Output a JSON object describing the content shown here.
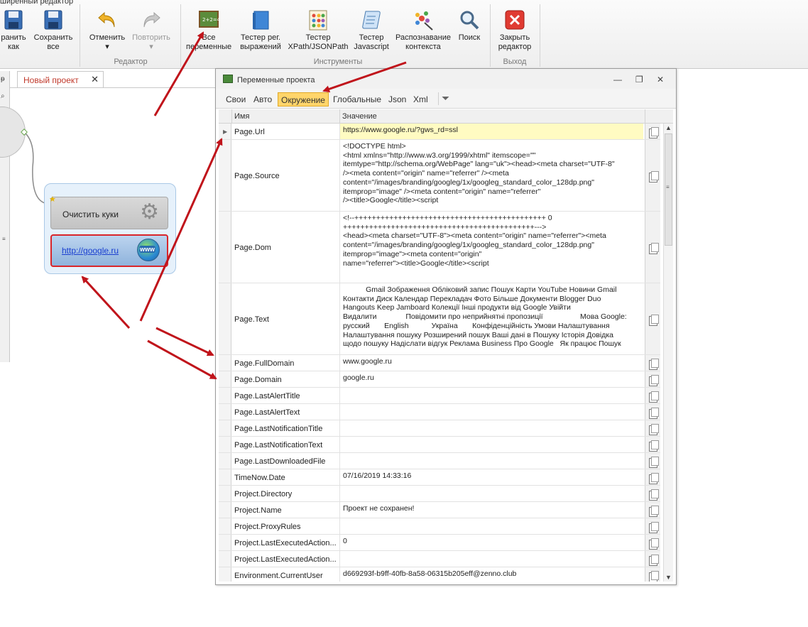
{
  "window_title": "ширенный редактор",
  "ribbon": {
    "buttons": [
      {
        "label": "ранить\nкак"
      },
      {
        "label": "Сохранить\nвсе"
      },
      {
        "label": "Отменить\n▾"
      },
      {
        "label": "Повторить\n▾"
      },
      {
        "label": "Все\nпеременные"
      },
      {
        "label": "Тестер рег.\nвыражений"
      },
      {
        "label": "Тестер\nXPath/JSONPath"
      },
      {
        "label": "Тестер\nJavascript"
      },
      {
        "label": "Распознавание\nконтекста"
      },
      {
        "label": "Поиск"
      },
      {
        "label": "Закрыть\nредактор"
      }
    ],
    "groups": {
      "editor": "Редактор",
      "tools": "Инструменты",
      "exit": "Выход"
    }
  },
  "document_tab": {
    "title": "Новый проект",
    "close": "✕"
  },
  "canvas": {
    "node_clear_label": "Очистить куки",
    "node_url_label": "http://google.ru",
    "globe_text": "www"
  },
  "variables_window": {
    "title": "Переменные проекта",
    "tabs": [
      "Свои",
      "Авто",
      "Окружение",
      "Глобальные",
      "Json",
      "Xml"
    ],
    "active_tab": "Окружение",
    "columns": {
      "name": "Имя",
      "value": "Значение"
    },
    "rows": [
      {
        "name": "Page.Url",
        "value": "https://www.google.ru/?gws_rd=ssl"
      },
      {
        "name": "Page.Source",
        "value": "<!DOCTYPE html>\n<html xmlns=\"http://www.w3.org/1999/xhtml\" itemscope=\"\"\nitemtype=\"http://schema.org/WebPage\" lang=\"uk\"><head><meta charset=\"UTF-8\"\n/><meta content=\"origin\" name=\"referrer\" /><meta\ncontent=\"/images/branding/googleg/1x/googleg_standard_color_128dp.png\"\nitemprop=\"image\" /><meta content=\"origin\" name=\"referrer\"\n/><title>Google</title><script"
      },
      {
        "name": "Page.Dom",
        "value": "<!--++++++++++++++++++++++++++++++++++++++++++++ 0\n++++++++++++++++++++++++++++++++++++++++++++--->\n<head><meta charset=\"UTF-8\"><meta content=\"origin\" name=\"referrer\"><meta\ncontent=\"/images/branding/googleg/1x/googleg_standard_color_128dp.png\"\nitemprop=\"image\"><meta content=\"origin\"\nname=\"referrer\"><title>Google</title><script"
      },
      {
        "name": "Page.Text",
        "value": "           Gmail Зображення Обліковий запис Пошук Карти YouTube Новини Gmail\nКонтакти Диск Календар Перекладач Фото Більше Документи Blogger Duo\nHangouts Keep Jamboard Колекції Інші продукти від Google Увійти\nВидалити              Повідомити про неприйнятні пропозиції                  Мова Google:\nрусский       English           Україна       Конфіденційність Умови Налаштування\nНалаштування пошуку Розширений пошук Ваші дані в Пошуку Історія Довідка\nщодо пошуку Надіслати відгук Реклама Business Про Google   Як працює Пошук"
      },
      {
        "name": "Page.FullDomain",
        "value": "www.google.ru"
      },
      {
        "name": "Page.Domain",
        "value": "google.ru"
      },
      {
        "name": "Page.LastAlertTitle",
        "value": ""
      },
      {
        "name": "Page.LastAlertText",
        "value": ""
      },
      {
        "name": "Page.LastNotificationTitle",
        "value": ""
      },
      {
        "name": "Page.LastNotificationText",
        "value": ""
      },
      {
        "name": "Page.LastDownloadedFile",
        "value": ""
      },
      {
        "name": "TimeNow.Date",
        "value": "07/16/2019 14:33:16"
      },
      {
        "name": "Project.Directory",
        "value": ""
      },
      {
        "name": "Project.Name",
        "value": "Проект не сохранен!"
      },
      {
        "name": "Project.ProxyRules",
        "value": ""
      },
      {
        "name": "Project.LastExecutedAction...",
        "value": "0"
      },
      {
        "name": "Project.LastExecutedAction...",
        "value": ""
      },
      {
        "name": "Environment.CurrentUser",
        "value": "d669293f-b9ff-40fb-8a58-06315b205eff@zenno.club"
      }
    ]
  },
  "colors": {
    "accent": "#ffd56a",
    "arrow": "#c0141b",
    "highlight": "#fffbc2"
  }
}
